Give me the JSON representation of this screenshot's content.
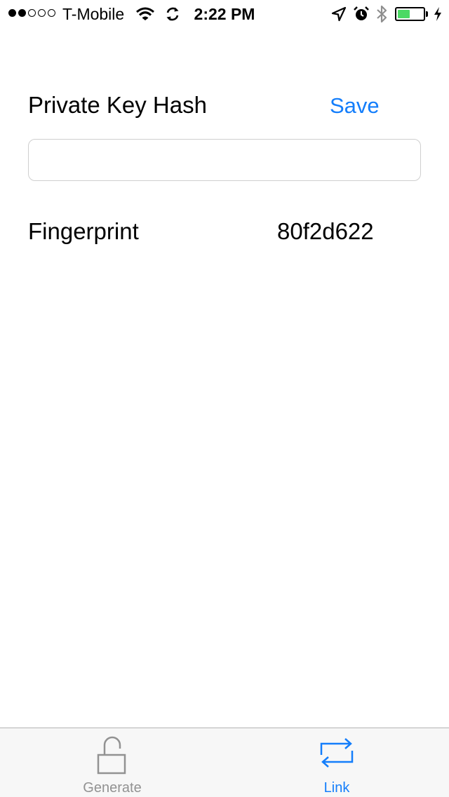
{
  "status_bar": {
    "signal_bars_filled": 2,
    "signal_bars_total": 5,
    "carrier": "T-Mobile",
    "time": "2:22 PM",
    "battery_level_percent": 48,
    "battery_color": "#4cd964"
  },
  "form": {
    "title": "Private Key Hash",
    "save_label": "Save",
    "hash_input_value": "",
    "fingerprint_label": "Fingerprint",
    "fingerprint_value": "80f2d622"
  },
  "tab_bar": {
    "tabs": [
      {
        "label": "Generate",
        "icon": "unlocked-padlock-icon",
        "selected": false
      },
      {
        "label": "Link",
        "icon": "repeat-arrows-icon",
        "selected": true
      }
    ]
  },
  "colors": {
    "accent": "#147efb",
    "inactive_tab": "#929292"
  }
}
